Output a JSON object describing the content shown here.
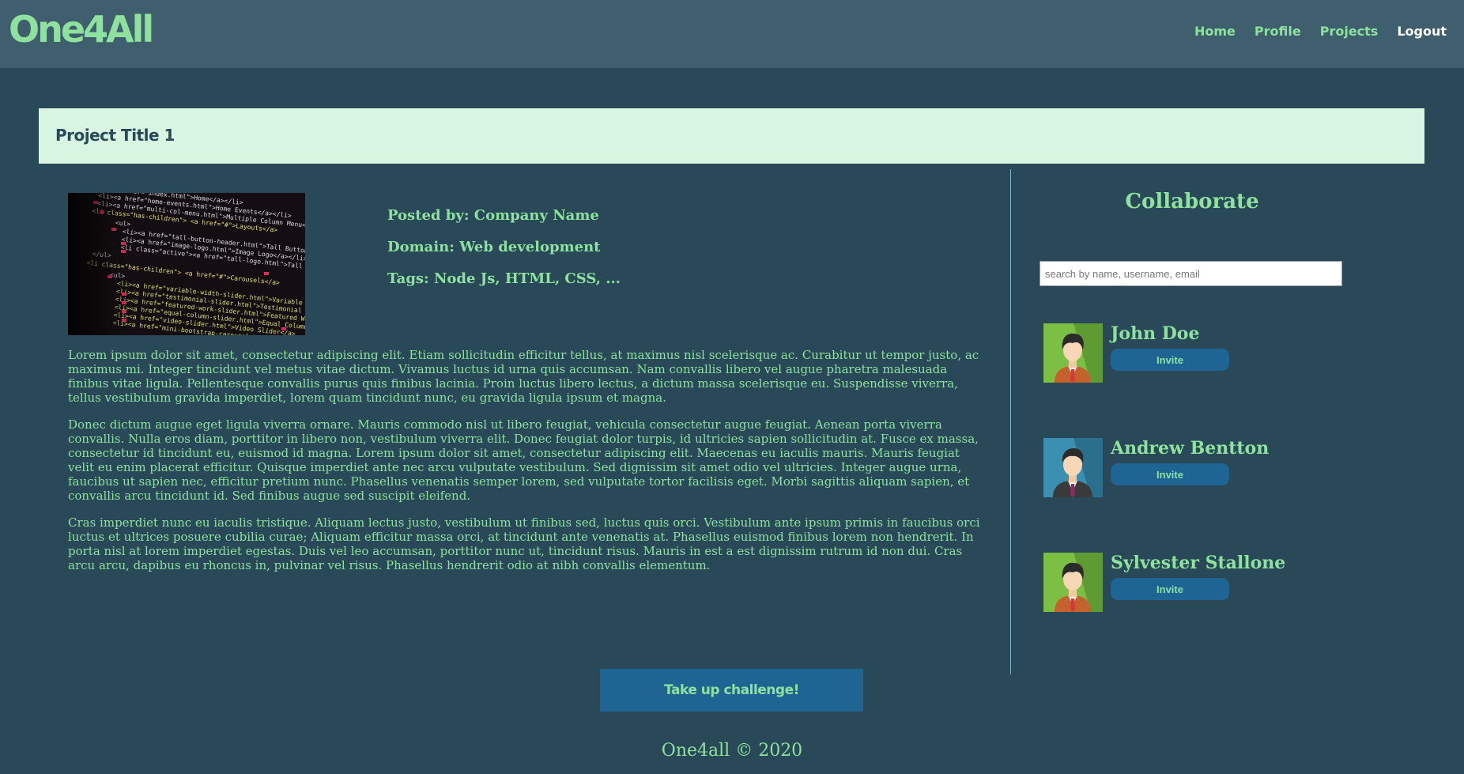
{
  "brand": {
    "logo": "One4All"
  },
  "nav": {
    "home": "Home",
    "profile": "Profile",
    "projects": "Projects",
    "logout": "Logout"
  },
  "project": {
    "title": "Project Title 1",
    "posted_by": "Posted by: Company Name",
    "domain": "Domain: Web development",
    "tags": "Tags: Node Js, HTML, CSS, ...",
    "paragraphs": [
      "Lorem ipsum dolor sit amet, consectetur adipiscing elit. Etiam sollicitudin efficitur tellus, at maximus nisl scelerisque ac. Curabitur ut tempor justo, ac maximus mi. Integer tincidunt vel metus vitae dictum. Vivamus luctus id urna quis accumsan. Nam convallis libero vel augue pharetra malesuada finibus vitae ligula. Pellentesque convallis purus quis finibus lacinia. Proin luctus libero lectus, a dictum massa scelerisque eu. Suspendisse viverra, tellus vestibulum gravida imperdiet, lorem quam tincidunt nunc, eu gravida ligula ipsum et magna.",
      "Donec dictum augue eget ligula viverra ornare. Mauris commodo nisl ut libero feugiat, vehicula consectetur augue feugiat. Aenean porta viverra convallis. Nulla eros diam, porttitor in libero non, vestibulum viverra elit. Donec feugiat dolor turpis, id ultricies sapien sollicitudin at. Fusce ex massa, consectetur id tincidunt eu, euismod id magna. Lorem ipsum dolor sit amet, consectetur adipiscing elit. Maecenas eu iaculis mauris. Mauris feugiat velit eu enim placerat efficitur. Quisque imperdiet ante nec arcu vulputate vestibulum. Sed dignissim sit amet odio vel ultricies. Integer augue urna, faucibus ut sapien nec, efficitur pretium nunc. Phasellus venenatis semper lorem, sed vulputate tortor facilisis eget. Morbi sagittis aliquam sapien, et convallis arcu tincidunt id. Sed finibus augue sed suscipit eleifend.",
      "Cras imperdiet nunc eu iaculis tristique. Aliquam lectus justo, vestibulum ut finibus sed, luctus quis orci. Vestibulum ante ipsum primis in faucibus orci luctus et ultrices posuere cubilia curae; Aliquam efficitur massa orci, at tincidunt ante venenatis at. Phasellus euismod finibus lorem non hendrerit. In porta nisl at lorem imperdiet egestas. Duis vel leo accumsan, porttitor nunc ut, tincidunt risus. Mauris in est a est dignissim rutrum id non dui. Cras arcu arcu, dapibus eu rhoncus in, pulvinar vel risus. Phasellus hendrerit odio at nibh convallis elementum."
    ]
  },
  "collaborate": {
    "title": "Collaborate",
    "search_placeholder": "search by name, username, email",
    "members": [
      {
        "name": "John Doe",
        "invite_label": "Invite"
      },
      {
        "name": "Andrew Bentton",
        "invite_label": "Invite"
      },
      {
        "name": "Sylvester Stallone",
        "invite_label": "Invite"
      }
    ]
  },
  "actions": {
    "challenge_label": "Take up challenge!"
  },
  "footer": {
    "text": "One4all © 2020"
  },
  "colors": {
    "bg": "#294858",
    "header": "#405f6e",
    "accent": "#8ee29e",
    "button": "#1e6594",
    "title_bar": "#d7f5e1"
  }
}
